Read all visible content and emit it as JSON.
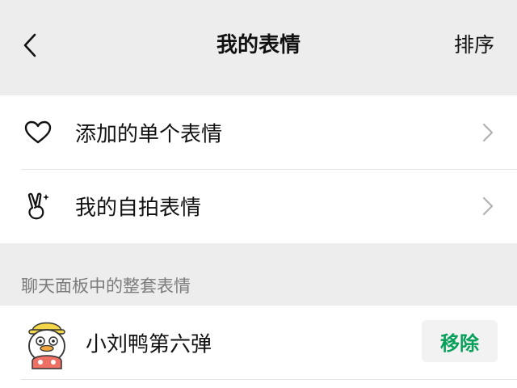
{
  "navbar": {
    "title": "我的表情",
    "action_label": "排序",
    "back_icon": "chevron-left-icon"
  },
  "menu": {
    "items": [
      {
        "label": "添加的单个表情",
        "icon": "heart-icon"
      },
      {
        "label": "我的自拍表情",
        "icon": "victory-hand-icon"
      }
    ]
  },
  "section": {
    "header": "聊天面板中的整套表情"
  },
  "packs": [
    {
      "name": "小刘鸭第六弹",
      "action_label": "移除",
      "thumbnail": "duck-sticker-icon"
    }
  ],
  "colors": {
    "background": "#ededed",
    "surface": "#ffffff",
    "accent": "#07a05a",
    "secondary_text": "#7b7b7b"
  }
}
